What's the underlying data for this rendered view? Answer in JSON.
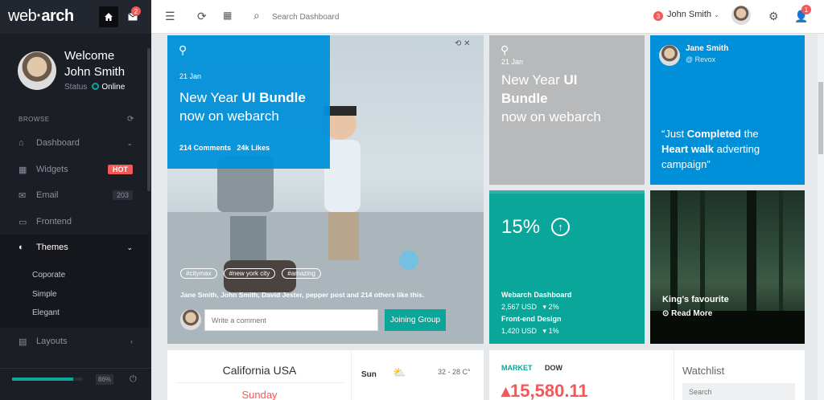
{
  "app": {
    "logo_a": "web",
    "logo_b": "arch",
    "mail_badge": "2"
  },
  "profile": {
    "welcome": "Welcome",
    "name": "John Smith",
    "status_label": "Status",
    "status_value": "Online"
  },
  "sidebar": {
    "browse": "BROWSE",
    "items": [
      {
        "label": "Dashboard",
        "icon": "home-icon"
      },
      {
        "label": "Widgets",
        "badge": "HOT",
        "icon": "grid-icon"
      },
      {
        "label": "Email",
        "count": "203",
        "icon": "mail-icon"
      },
      {
        "label": "Frontend",
        "icon": "monitor-icon"
      },
      {
        "label": "Themes",
        "icon": "contrast-icon"
      },
      {
        "label": "Layouts",
        "icon": "file-icon"
      }
    ],
    "sub": [
      "Coporate",
      "Simple",
      "Elegant"
    ],
    "progress_pct": "86%",
    "progress_value": 0.86
  },
  "header": {
    "search_placeholder": "Search Dashboard",
    "user_badge": "3",
    "user_name": "John Smith",
    "alert_badge": "1"
  },
  "tile_main": {
    "date": "21 Jan",
    "title_a": "New Year ",
    "title_b": "UI Bundle",
    "subtitle": "now on webarch",
    "comments": "214 Comments",
    "likes": "24k Likes",
    "tags": [
      "#citymax",
      "#new york city",
      "#amazing"
    ],
    "likers": "Jane Smith, John Smith, David Jester, pepper post and 214 others like this.",
    "comment_placeholder": "Write a comment",
    "join": "Joining Group"
  },
  "tile_grey": {
    "date": "21 Jan",
    "title_a": "New Year ",
    "title_b": "UI",
    "title_c": "Bundle",
    "subtitle": "now on webarch"
  },
  "tile_quote": {
    "name": "Jane Smith",
    "handle": "@ Revox",
    "q1": "“Just ",
    "q2": "Completed",
    "q3": " the",
    "q4": "Heart walk",
    "q5": " adverting",
    "q6": "campaign”"
  },
  "tile_teal": {
    "pct": "15%",
    "l1": "Webarch Dashboard",
    "v1": "2,567 USD",
    "c1": "2%",
    "l2": "Front-end Design",
    "v2": "1,420 USD",
    "c2": "1%"
  },
  "tile_photo": {
    "caption": "King's favourite",
    "read": "Read More"
  },
  "weather": {
    "city": "California USA",
    "day": "Sunday",
    "row_day": "Sun",
    "temp": "32 - 28 C°"
  },
  "market": {
    "a": "MARKET",
    "b": "DOW",
    "value": "15,580.11"
  },
  "watchlist": {
    "title": "Watchlist",
    "search": "Search"
  }
}
